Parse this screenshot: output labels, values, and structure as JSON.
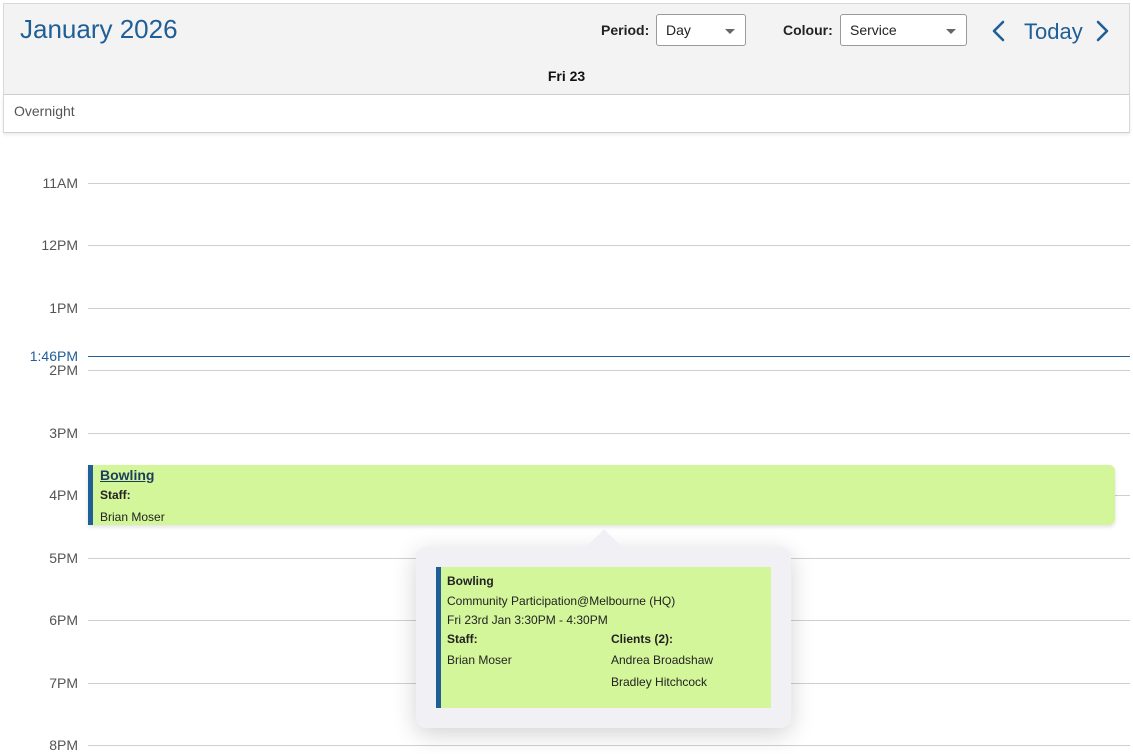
{
  "header": {
    "title": "January 2026",
    "period_label": "Period:",
    "period_value": "Day",
    "colour_label": "Colour:",
    "colour_value": "Service",
    "today_label": "Today",
    "day_label": "Fri 23"
  },
  "overnight_label": "Overnight",
  "time_labels": [
    "11AM",
    "12PM",
    "1PM",
    "2PM",
    "3PM",
    "4PM",
    "5PM",
    "6PM",
    "7PM",
    "8PM"
  ],
  "current_time_label": "1:46PM",
  "event": {
    "title": "Bowling",
    "staff_label": "Staff:",
    "staff_name": "Brian Moser",
    "color": "#d4f69a",
    "accent": "#1f5e96"
  },
  "popover": {
    "title": "Bowling",
    "location": "Community Participation@Melbourne (HQ)",
    "time": "Fri 23rd Jan 3:30PM - 4:30PM",
    "staff_label": "Staff:",
    "staff_name": "Brian Moser",
    "clients_label": "Clients (2):",
    "clients": [
      "Andrea Broadshaw",
      "Bradley Hitchcock"
    ]
  },
  "icons": {
    "prev": "chevron-left-icon",
    "next": "chevron-right-icon",
    "caret": "caret-down-icon"
  }
}
